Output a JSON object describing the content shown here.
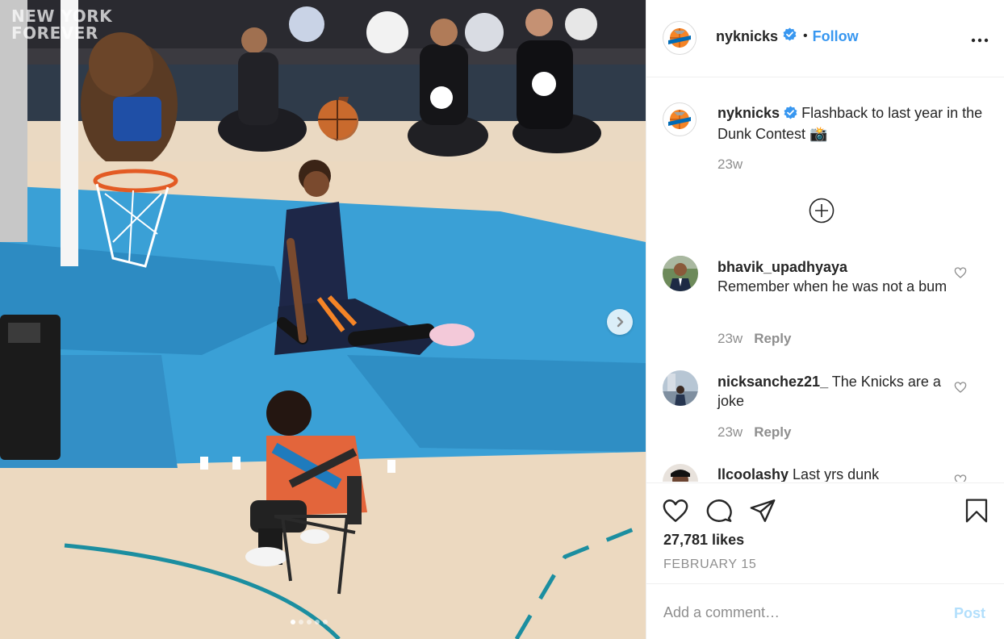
{
  "media": {
    "watermark_line1": "NEW YORK",
    "watermark_line2": "FOREVER",
    "next_icon": "chevron-right-icon",
    "carousel": {
      "count": 5,
      "active_index": 0
    }
  },
  "header": {
    "username": "nyknicks",
    "separator": "•",
    "follow_label": "Follow",
    "avatar_icon": "knicks-logo-icon",
    "more_icon": "more-horizontal-icon"
  },
  "caption": {
    "username": "nyknicks",
    "text": "Flashback to last year in the Dunk Contest 📸",
    "time": "23w",
    "load_more_icon": "plus-circle-icon"
  },
  "comments": [
    {
      "username": "bhavik_upadhyaya",
      "text": "Remember when he was not a bum",
      "time": "23w",
      "reply_label": "Reply"
    },
    {
      "username": "nicksanchez21_",
      "text": "The Knicks are a joke",
      "time": "23w",
      "reply_label": "Reply"
    },
    {
      "username": "llcoolashy",
      "text": "Last yrs dunk",
      "time": "",
      "reply_label": ""
    }
  ],
  "actions": {
    "likes": "27,781 likes",
    "date": "FEBRUARY 15",
    "icons": [
      "heart-icon",
      "comment-icon",
      "share-icon",
      "bookmark-icon"
    ]
  },
  "add_comment": {
    "placeholder": "Add a comment…",
    "post_label": "Post"
  },
  "colors": {
    "link_blue": "#3897f0",
    "post_disabled": "#b2dffc",
    "knicks_orange": "#f58426",
    "knicks_blue": "#006bb6",
    "text_primary": "#262626",
    "text_secondary": "#8e8e8e"
  }
}
